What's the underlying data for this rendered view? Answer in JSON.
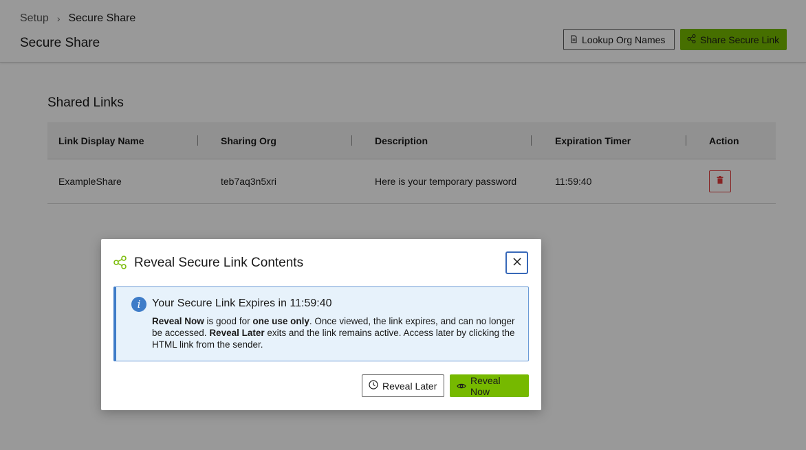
{
  "breadcrumb": {
    "root": "Setup",
    "separator": "›",
    "current": "Secure Share"
  },
  "page_title": "Secure Share",
  "header_buttons": {
    "lookup": "Lookup Org Names",
    "share": "Share Secure Link"
  },
  "shared_links": {
    "title": "Shared Links",
    "columns": [
      "Link Display Name",
      "Sharing Org",
      "Description",
      "Expiration Timer",
      "Action"
    ],
    "rows": [
      {
        "name": "ExampleShare",
        "org": "teb7aq3n5xri",
        "description": "Here is your temporary password",
        "timer": "11:59:40"
      }
    ]
  },
  "modal": {
    "title": "Reveal Secure Link Contents",
    "info_heading": "Your Secure Link Expires in 11:59:40",
    "info_body": {
      "p1_bold": "Reveal Now",
      "p2": " is good for ",
      "p3_bold": "one use only",
      "p4": ". Once viewed, the link expires, and can no longer be accessed. ",
      "p5_bold": "Reveal Later",
      "p6": " exits and the link remains active. Access later by clicking the HTML link from the sender."
    },
    "reveal_later": "Reveal Later",
    "reveal_now": "Reveal Now"
  },
  "colors": {
    "accent_green": "#76b900",
    "info_blue": "#3e7cc8",
    "danger_red": "#e23b3b",
    "focus_blue": "#3768b8"
  },
  "icons": [
    "file-icon",
    "share-icon",
    "trash-icon",
    "close-icon",
    "info-icon",
    "clock-icon",
    "eye-icon"
  ]
}
